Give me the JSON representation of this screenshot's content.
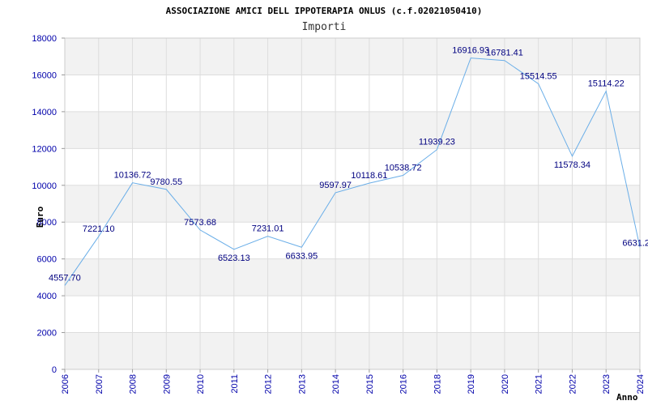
{
  "chart_data": {
    "type": "line",
    "title": "ASSOCIAZIONE AMICI DELL IPPOTERAPIA ONLUS (c.f.02021050410)",
    "subtitle": "Importi",
    "xlabel": "Anno",
    "ylabel": "Euro",
    "ylim": [
      0,
      18000
    ],
    "yticks": [
      0,
      2000,
      4000,
      6000,
      8000,
      10000,
      12000,
      14000,
      16000,
      18000
    ],
    "categories": [
      "2006",
      "2007",
      "2008",
      "2009",
      "2010",
      "2011",
      "2012",
      "2013",
      "2014",
      "2015",
      "2016",
      "2018",
      "2019",
      "2020",
      "2021",
      "2022",
      "2023",
      "2024"
    ],
    "series": [
      {
        "values": [
          4557.7,
          7221.1,
          10136.72,
          9780.55,
          7573.68,
          6523.13,
          7231.01,
          6633.95,
          9597.97,
          10118.61,
          10538.72,
          11939.23,
          16916.93,
          16781.41,
          15514.55,
          11578.34,
          15114.22,
          6631.2
        ],
        "labels": [
          "4557.70",
          "7221.10",
          "10136.72",
          "9780.55",
          "7573.68",
          "6523.13",
          "7231.01",
          "6633.95",
          "9597.97",
          "10118.61",
          "10538.72",
          "11939.23",
          "16916.93",
          "16781.41",
          "15514.55",
          "11578.34",
          "15114.22",
          "6631.2"
        ]
      }
    ],
    "grid": true,
    "colors": {
      "line": "#6aaee8",
      "band": "#f2f2f2",
      "grid": "#dddddd",
      "tick": "#0000aa",
      "label": "#000080"
    }
  }
}
